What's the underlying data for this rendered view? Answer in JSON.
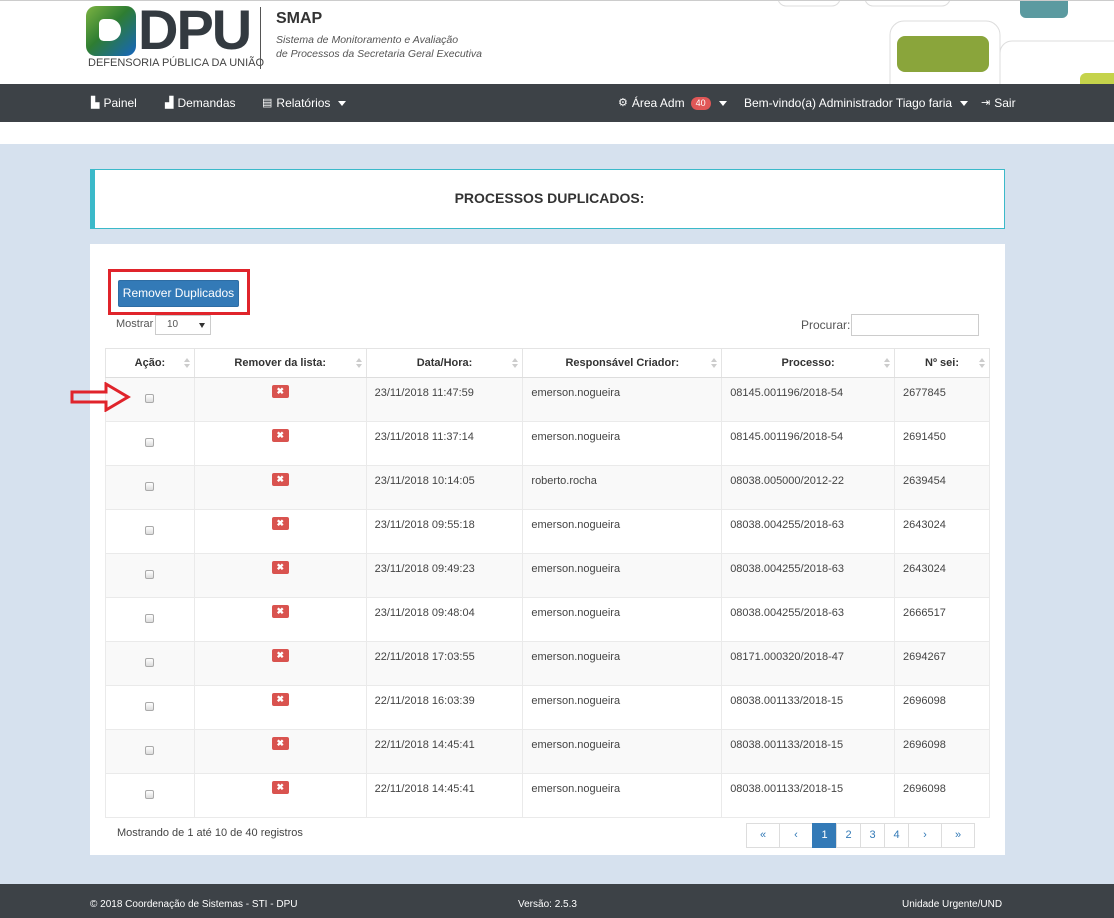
{
  "header": {
    "logo_text": "DPU",
    "logo_subtitle": "DEFENSORIA PÚBLICA DA UNIÃO",
    "app_title": "SMAP",
    "app_desc_1": "Sistema de Monitoramento e Avaliação",
    "app_desc_2": "de Processos da Secretaria Geral Executiva"
  },
  "nav": {
    "painel": "Painel",
    "demandas": "Demandas",
    "relatorios": "Relatórios",
    "area_adm": "Área Adm",
    "area_adm_badge": "40",
    "welcome": "Bem-vindo(a) Administrador Tiago faria",
    "sair": "Sair"
  },
  "page": {
    "title": "PROCESSOS DUPLICADOS:",
    "remove_button": "Remover Duplicados",
    "show_label": "Mostrar",
    "show_value": "10",
    "search_label": "Procurar:",
    "search_value": ""
  },
  "table": {
    "headers": [
      "Ação:",
      "Remover da lista:",
      "Data/Hora:",
      "Responsável Criador:",
      "Processo:",
      "Nº sei:"
    ],
    "rows": [
      {
        "datahora": "23/11/2018 11:47:59",
        "responsavel": "emerson.nogueira",
        "processo": "08145.001196/2018-54",
        "sei": "2677845"
      },
      {
        "datahora": "23/11/2018 11:37:14",
        "responsavel": "emerson.nogueira",
        "processo": "08145.001196/2018-54",
        "sei": "2691450"
      },
      {
        "datahora": "23/11/2018 10:14:05",
        "responsavel": "roberto.rocha",
        "processo": "08038.005000/2012-22",
        "sei": "2639454"
      },
      {
        "datahora": "23/11/2018 09:55:18",
        "responsavel": "emerson.nogueira",
        "processo": "08038.004255/2018-63",
        "sei": "2643024"
      },
      {
        "datahora": "23/11/2018 09:49:23",
        "responsavel": "emerson.nogueira",
        "processo": "08038.004255/2018-63",
        "sei": "2643024"
      },
      {
        "datahora": "23/11/2018 09:48:04",
        "responsavel": "emerson.nogueira",
        "processo": "08038.004255/2018-63",
        "sei": "2666517"
      },
      {
        "datahora": "22/11/2018 17:03:55",
        "responsavel": "emerson.nogueira",
        "processo": "08171.000320/2018-47",
        "sei": "2694267"
      },
      {
        "datahora": "22/11/2018 16:03:39",
        "responsavel": "emerson.nogueira",
        "processo": "08038.001133/2018-15",
        "sei": "2696098"
      },
      {
        "datahora": "22/11/2018 14:45:41",
        "responsavel": "emerson.nogueira",
        "processo": "08038.001133/2018-15",
        "sei": "2696098"
      },
      {
        "datahora": "22/11/2018 14:45:41",
        "responsavel": "emerson.nogueira",
        "processo": "08038.001133/2018-15",
        "sei": "2696098"
      }
    ],
    "remove_glyph": "✖"
  },
  "pagination": {
    "info": "Mostrando de 1 até 10 de 40 registros",
    "first": "«",
    "prev": "‹",
    "pages": [
      "1",
      "2",
      "3",
      "4"
    ],
    "active_page": "1",
    "next": "›",
    "last": "»"
  },
  "footer": {
    "copyright": "© 2018 Coordenação de Sistemas - STI - DPU",
    "version": "Versão: 2.5.3",
    "unit": "Unidade Urgente/UND"
  },
  "colors": {
    "navbar": "#3d4247",
    "primary": "#337ab7",
    "danger": "#d9534f",
    "accent": "#3bb9c9",
    "background": "#d6e1ee",
    "annotation": "#e0242b"
  },
  "icons": {
    "painel": "dashboard-icon",
    "demandas": "bar-chart-icon",
    "relatorios": "report-list-icon",
    "area_adm": "gear-icon",
    "sair": "sign-out-icon"
  }
}
